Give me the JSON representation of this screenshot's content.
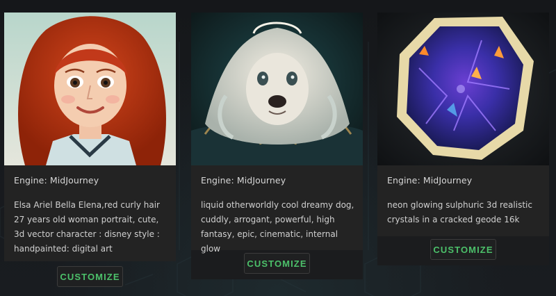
{
  "cards": [
    {
      "engine": "Engine: MidJourney",
      "prompt": "Elsa Ariel Bella Elena,red curly hair 27 years old woman portrait, cute, 3d vector character : disney style : handpainted: digital art",
      "button": "CUSTOMIZE",
      "image_alt": "portrait-image"
    },
    {
      "engine": "Engine: MidJourney",
      "prompt": "liquid otherworldly cool dreamy dog, cuddly, arrogant, powerful, high fantasy, epic, cinematic, internal glow",
      "button": "CUSTOMIZE",
      "image_alt": "dog-image"
    },
    {
      "engine": "Engine: MidJourney",
      "prompt": "neon glowing sulphuric 3d realistic crystals in a cracked geode 16k",
      "button": "CUSTOMIZE",
      "image_alt": "geode-image"
    }
  ],
  "colors": {
    "accent": "#4cc06a",
    "card_body": "#232323",
    "background": "#16181b"
  }
}
